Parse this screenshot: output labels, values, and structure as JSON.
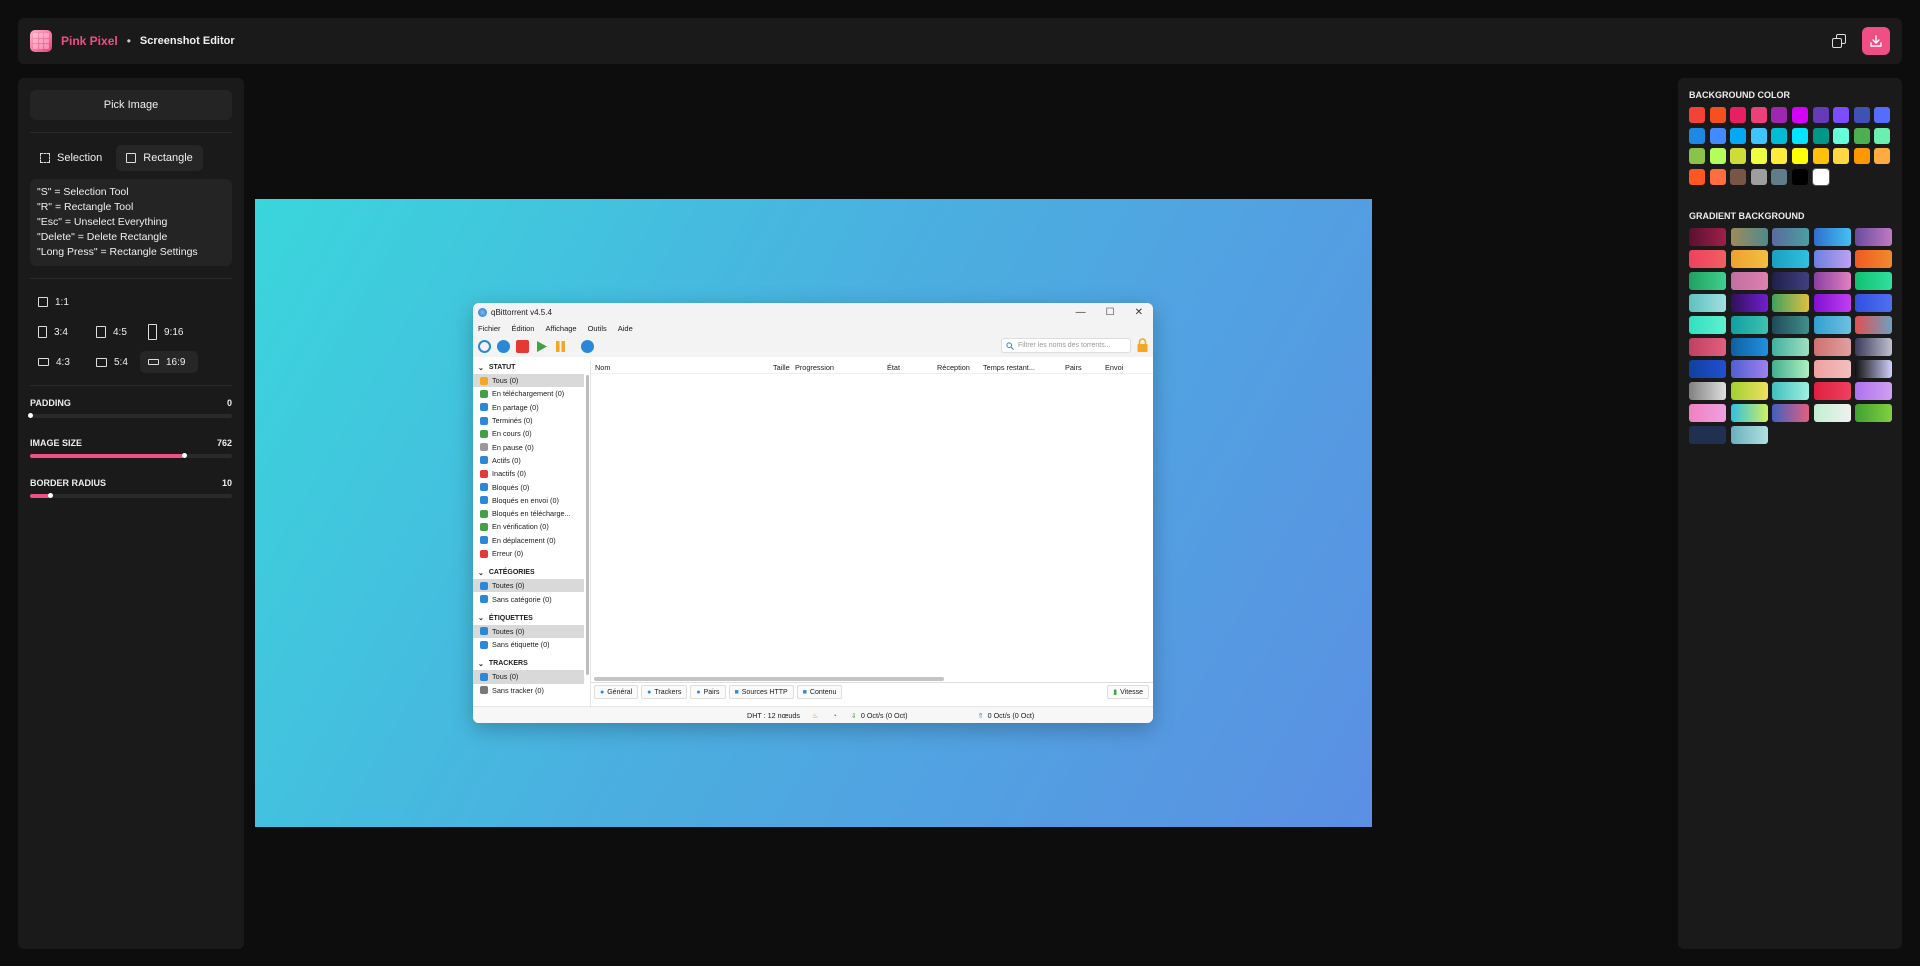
{
  "app": {
    "brand": "Pink Pixel",
    "separator": "•",
    "title": "Screenshot Editor"
  },
  "left_panel": {
    "pick_image": "Pick Image",
    "tools": [
      {
        "label": "Selection",
        "icon": "selection-icon"
      },
      {
        "label": "Rectangle",
        "icon": "rectangle-icon"
      }
    ],
    "shortcuts": [
      "\"S\" = Selection Tool",
      "\"R\" = Rectangle Tool",
      "\"Esc\" = Unselect Everything",
      "\"Delete\" = Delete Rectangle",
      "\"Long Press\" = Rectangle Settings"
    ],
    "ratios": [
      "1:1",
      "3:4",
      "4:5",
      "9:16",
      "4:3",
      "5:4",
      "16:9"
    ],
    "active_ratio": "16:9",
    "sliders": [
      {
        "label": "PADDING",
        "value": "0",
        "fraction": 0.0
      },
      {
        "label": "IMAGE SIZE",
        "value": "762",
        "fraction": 0.76
      },
      {
        "label": "BORDER RADIUS",
        "value": "10",
        "fraction": 0.1
      }
    ]
  },
  "right_panel": {
    "background_color_title": "BACKGROUND COLOR",
    "colors": [
      "#f44336",
      "#f4511e",
      "#e91e63",
      "#ec407a",
      "#9c27b0",
      "#d500f9",
      "#673ab7",
      "#7c4dff",
      "#3f51b5",
      "#536dfe",
      "#1e88e5",
      "#448aff",
      "#03a9f4",
      "#40c4ff",
      "#00bcd4",
      "#00e5ff",
      "#009688",
      "#64ffda",
      "#4caf50",
      "#69f0ae",
      "#8bc34a",
      "#b2ff59",
      "#cddc39",
      "#eeff41",
      "#ffeb3b",
      "#ffff00",
      "#ffc107",
      "#ffd740",
      "#ff9800",
      "#ffab40",
      "#ff5722",
      "#ff6e40",
      "#795548",
      "#9e9e9e",
      "#607d8b",
      "#000000",
      "#ffffff"
    ],
    "gradient_title": "GRADIENT BACKGROUND",
    "gradients": [
      [
        "#5a1030",
        "#a0204a"
      ],
      [
        "#a08a5a",
        "#4e8a8a"
      ],
      [
        "#5a6aa0",
        "#4aa0a0"
      ],
      [
        "#2f6fd0",
        "#45c0f0"
      ],
      [
        "#6a4aa0",
        "#c07ac0"
      ],
      [
        "#f04060",
        "#f06060"
      ],
      [
        "#f0a030",
        "#f0c040"
      ],
      [
        "#1aa0c0",
        "#30c0e0"
      ],
      [
        "#6a80e0",
        "#c0a0f0"
      ],
      [
        "#f05a20",
        "#f08a30"
      ],
      [
        "#20a060",
        "#40d090"
      ],
      [
        "#c070a0",
        "#e080b0"
      ],
      [
        "#20204a",
        "#404080"
      ],
      [
        "#8a40a0",
        "#e080c0"
      ],
      [
        "#10c070",
        "#30e0a0"
      ],
      [
        "#60c0c0",
        "#a0e0e0"
      ],
      [
        "#30105a",
        "#7020d0"
      ],
      [
        "#40a060",
        "#e0c040"
      ],
      [
        "#8010d0",
        "#c040f0"
      ],
      [
        "#3050e0",
        "#5070f0"
      ],
      [
        "#30e0c0",
        "#60f0d0"
      ],
      [
        "#10a0a0",
        "#40c0b0"
      ],
      [
        "#204a5a",
        "#40908a"
      ],
      [
        "#30a0d0",
        "#70c0e0"
      ],
      [
        "#e05050",
        "#70a0c0"
      ],
      [
        "#c04060",
        "#e06080"
      ],
      [
        "#1060a0",
        "#2090e0"
      ],
      [
        "#40b0a0",
        "#a0e0c0"
      ],
      [
        "#d07070",
        "#e0a0a0"
      ],
      [
        "#3a3a5a",
        "#c0c0d0"
      ],
      [
        "#1040a0",
        "#2050d0"
      ],
      [
        "#5060d0",
        "#a080f0"
      ],
      [
        "#40b090",
        "#b0f0c0"
      ],
      [
        "#f0a0a0",
        "#f0c0c0"
      ],
      [
        "#101010",
        "#d0d0ff"
      ],
      [
        "#808080",
        "#e0e0e0"
      ],
      [
        "#a0d030",
        "#f0e060"
      ],
      [
        "#40c0c0",
        "#a0f0e0"
      ],
      [
        "#e02040",
        "#f04060"
      ],
      [
        "#b070f0",
        "#d0a0f0"
      ],
      [
        "#f080c0",
        "#f0a0e0"
      ],
      [
        "#30c0e0",
        "#d0f060"
      ],
      [
        "#4060c0",
        "#e06080"
      ],
      [
        "#c0f0d0",
        "#f0f0f0"
      ],
      [
        "#40a030",
        "#80d040"
      ],
      [
        "#203050",
        "#203050"
      ],
      [
        "#6ab0c0",
        "#b0e0e0"
      ]
    ]
  },
  "qbt": {
    "title": "qBittorrent v4.5.4",
    "menu": [
      "Fichier",
      "Édition",
      "Affichage",
      "Outils",
      "Aide"
    ],
    "filter_placeholder": "Filtrer les noms des torrents...",
    "statut_header": "STATUT",
    "statut": [
      "Tous (0)",
      "En téléchargement (0)",
      "En partage (0)",
      "Terminés (0)",
      "En cours (0)",
      "En pause (0)",
      "Actifs (0)",
      "Inactifs (0)",
      "Bloqués (0)",
      "Bloqués en envoi (0)",
      "Bloqués en télécharge...",
      "En vérification (0)",
      "En déplacement (0)",
      "Erreur (0)"
    ],
    "categories_header": "CATÉGORIES",
    "categories": [
      "Toutes (0)",
      "Sans catégorie (0)"
    ],
    "etiquettes_header": "ÉTIQUETTES",
    "etiquettes": [
      "Toutes (0)",
      "Sans étiquette (0)"
    ],
    "trackers_header": "TRACKERS",
    "trackers": [
      "Tous (0)",
      "Sans tracker (0)"
    ],
    "columns": [
      "Nom",
      "Taille",
      "Progression",
      "État",
      "Réception",
      "Temps restant...",
      "Pairs",
      "Envoi"
    ],
    "tabs": [
      "Général",
      "Trackers",
      "Pairs",
      "Sources HTTP",
      "Contenu"
    ],
    "speed_tab": "Vitesse",
    "status": {
      "dht": "DHT : 12 nœuds",
      "down": "0 Oct/s (0 Oct)",
      "up": "0 Oct/s (0 Oct)"
    }
  }
}
